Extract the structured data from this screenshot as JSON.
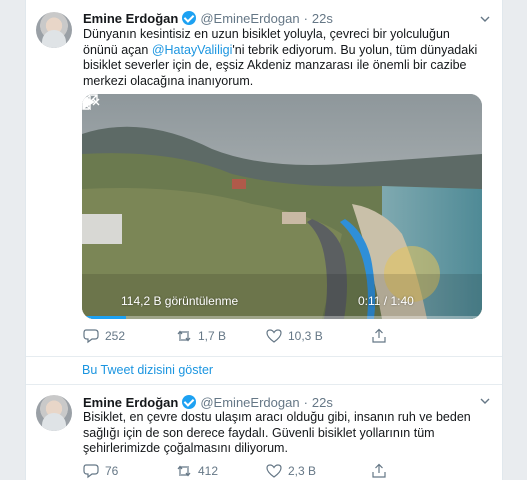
{
  "tweets": [
    {
      "name": "Emine Erdoğan",
      "handle": "@EmineErdogan",
      "dot": "·",
      "time": "22s",
      "text_parts": {
        "a": "Dünyanın kesintisiz en uzun bisiklet yoluyla, çevreci bir yolculuğun önünü açan ",
        "mention": "@HatayValiligi",
        "b": "'ni tebrik ediyorum. Bu yolun, tüm dünyadaki bisiklet severler için de, eşsiz Akdeniz manzarası ile önemli bir cazibe merkezi olacağına inanıyorum."
      },
      "video": {
        "views": "114,2 B görüntülenme",
        "time": "0:11 / 1:40",
        "progress": 0.11
      },
      "actions": {
        "replies": "252",
        "retweets": "1,7 B",
        "likes": "10,3 B"
      }
    },
    {
      "name": "Emine Erdoğan",
      "handle": "@EmineErdogan",
      "dot": "·",
      "time": "22s",
      "text": "Bisiklet, en çevre dostu ulaşım aracı olduğu gibi, insanın ruh ve beden sağlığı için de son derece faydalı. Güvenli bisiklet yollarının tüm şehirlerimizde çoğalmasını diliyorum.",
      "actions": {
        "replies": "76",
        "retweets": "412",
        "likes": "2,3 B"
      }
    }
  ],
  "thread_link": "Bu Tweet dizisini göster",
  "colors": {
    "accent": "#1da1f2",
    "link": "#1b95e0",
    "muted": "#657786"
  },
  "icons": [
    "verified-badge-icon",
    "caret-down-icon",
    "play-icon",
    "mute-icon",
    "expand-icon",
    "reply-icon",
    "retweet-icon",
    "like-icon",
    "share-icon"
  ]
}
